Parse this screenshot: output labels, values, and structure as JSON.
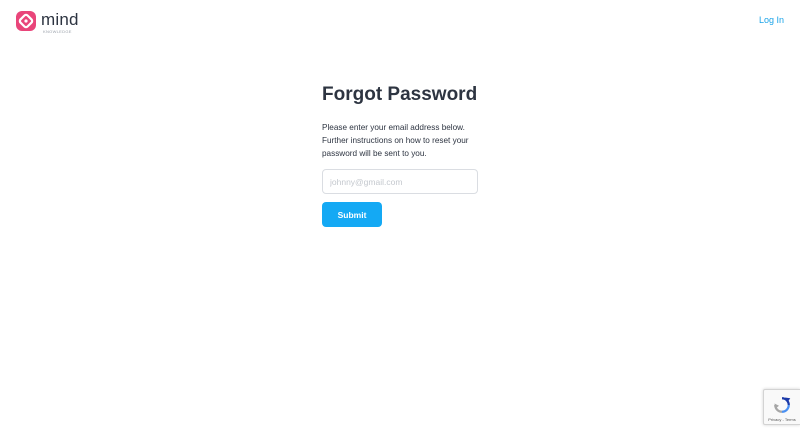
{
  "header": {
    "logo_text": "mind",
    "logo_subtext": "KNOWLEDGE",
    "login_label": "Log In"
  },
  "form": {
    "title": "Forgot Password",
    "instructions": "Please enter your email address below. Further instructions on how to reset your password will be sent to you.",
    "email_placeholder": "johnny@gmail.com",
    "email_value": "",
    "submit_label": "Submit"
  },
  "recaptcha": {
    "links": "Privacy - Terms"
  },
  "colors": {
    "brand_pink": "#e9457a",
    "accent_blue": "#14a9f4",
    "link_blue": "#1aa3e8",
    "text_dark": "#2d3441"
  },
  "icons": {
    "logo": "mind-logo-icon",
    "recaptcha": "recaptcha-icon"
  }
}
